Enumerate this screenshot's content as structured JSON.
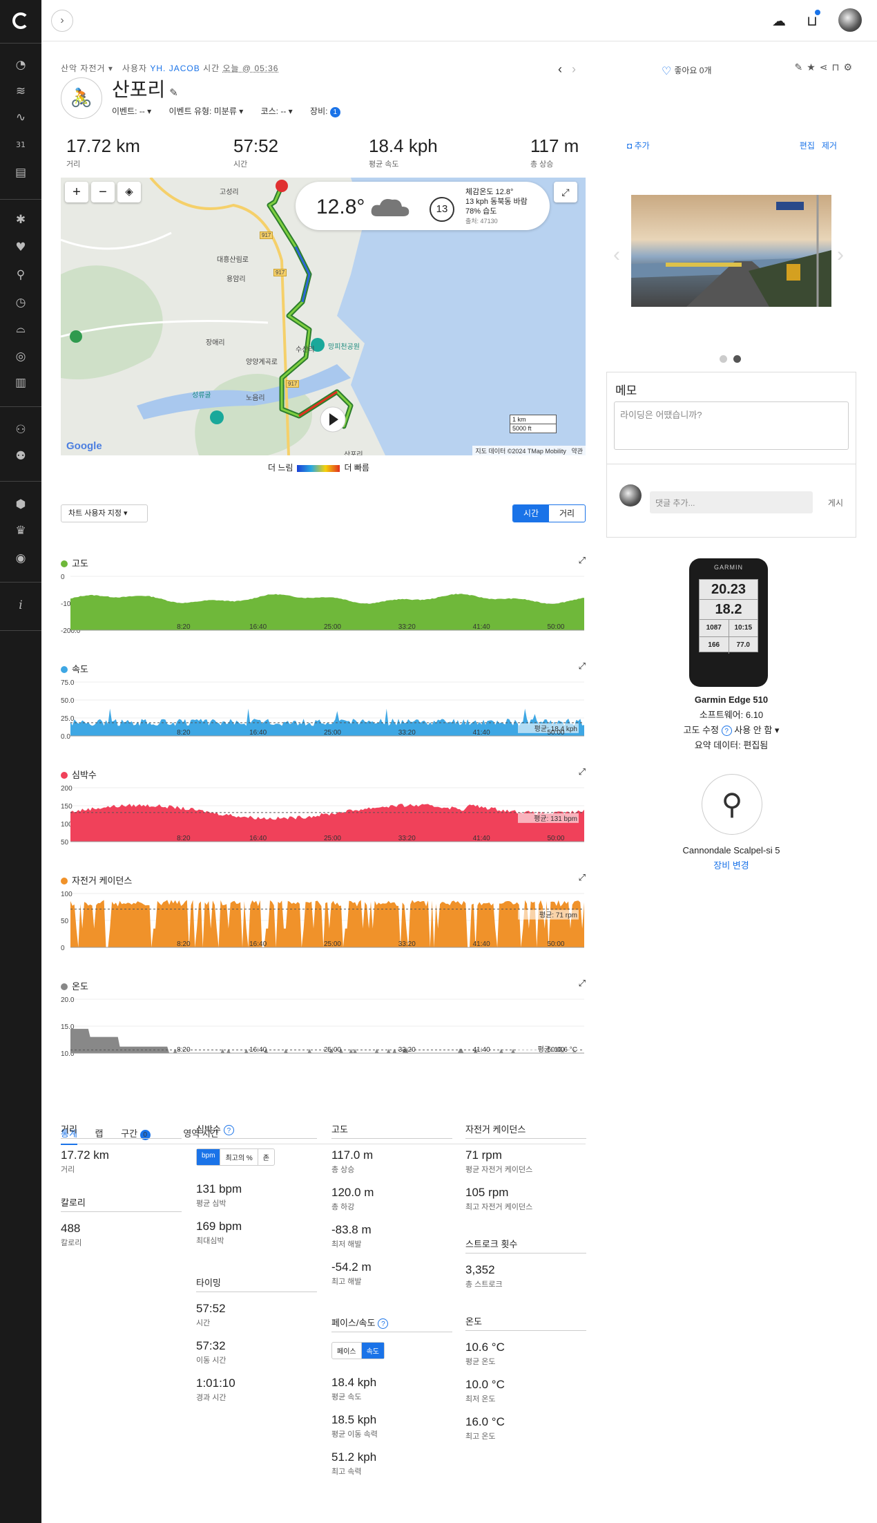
{
  "breadcrumb": {
    "type": "산악 자전거",
    "user_prefix": "사용자",
    "user": "YH. JACOB",
    "time_prefix": "시간",
    "time": "오늘 @ 05:36"
  },
  "activity": {
    "title": "산포리",
    "event_label": "이벤트:",
    "event_value": "--",
    "event_type_label": "이벤트 유형:",
    "event_type_value": "미분류",
    "course_label": "코스:",
    "course_value": "--",
    "gear_label": "장비:",
    "gear_count": "1"
  },
  "summary": [
    {
      "value": "17.72 km",
      "label": "거리"
    },
    {
      "value": "57:52",
      "label": "시간"
    },
    {
      "value": "18.4 kph",
      "label": "평균 속도"
    },
    {
      "value": "117 m",
      "label": "총 상승"
    }
  ],
  "map": {
    "places": [
      "고성리",
      "용암리",
      "대흥산림로",
      "장애리",
      "수산리",
      "양양계곡로",
      "성류굴",
      "노음리",
      "산포리",
      "917",
      "917",
      "917",
      "망피천공원"
    ],
    "attribution": "지도 데이터 ©2024 TMap Mobility",
    "terms": "약관",
    "google": "Google",
    "scale_km": "1 km",
    "scale_ft": "5000 ft",
    "weather": {
      "temp": "12.8°",
      "wind_speed": "13",
      "feels": "체감온도 12.8°",
      "wind": "13 kph 동북동 바람",
      "humidity": "78% 습도",
      "source": "출처: 47130"
    }
  },
  "map_legend": {
    "slow": "더 느림",
    "fast": "더 빠름"
  },
  "chart_controls": {
    "custom": "차트 사용자 지정",
    "time": "시간",
    "distance": "거리"
  },
  "x_ticks": [
    "8:20",
    "16:40",
    "25:00",
    "33:20",
    "41:40",
    "50:00"
  ],
  "charts": {
    "elevation": {
      "title": "고도",
      "color": "#6fb83a",
      "y_ticks": [
        "0",
        "-100.0",
        "-200.0"
      ],
      "ylim": [
        -200,
        0
      ]
    },
    "speed": {
      "title": "속도",
      "color": "#3ea7e4",
      "y_ticks": [
        "75.0",
        "50.0",
        "25.0",
        "0.0"
      ],
      "ylim": [
        0,
        75
      ],
      "avg_label": "평균: 18.4 kph",
      "avg": 18.4
    },
    "heart_rate": {
      "title": "심박수",
      "color": "#f0415a",
      "y_ticks": [
        "200",
        "150",
        "100",
        "50"
      ],
      "ylim": [
        50,
        200
      ],
      "avg_label": "평균: 131 bpm",
      "avg": 131
    },
    "cadence": {
      "title": "자전거 케이던스",
      "color": "#f0922a",
      "y_ticks": [
        "100",
        "50",
        "0"
      ],
      "ylim": [
        0,
        100
      ],
      "avg_label": "평균: 71 rpm",
      "avg": 71
    },
    "temperature": {
      "title": "온도",
      "color": "#888888",
      "y_ticks": [
        "20.0",
        "15.0",
        "10.0"
      ],
      "ylim": [
        10,
        20
      ],
      "avg_label": "평균: 10.6 °C",
      "avg": 10.6
    }
  },
  "tabs": [
    "통계",
    "랩",
    "구간",
    "영역 시간"
  ],
  "segments_count": "0",
  "stats": {
    "distance": {
      "title": "거리",
      "items": [
        {
          "value": "17.72 km",
          "label": "거리"
        }
      ]
    },
    "calories": {
      "title": "칼로리",
      "items": [
        {
          "value": "488",
          "label": "칼로리"
        }
      ]
    },
    "heart_rate": {
      "title": "심박수",
      "toggle": [
        "bpm",
        "최고의 %",
        "존"
      ],
      "items": [
        {
          "value": "131 bpm",
          "label": "평균 심박"
        },
        {
          "value": "169 bpm",
          "label": "최대심박"
        }
      ]
    },
    "timing": {
      "title": "타이밍",
      "items": [
        {
          "value": "57:52",
          "label": "시간"
        },
        {
          "value": "57:32",
          "label": "이동 시간"
        },
        {
          "value": "1:01:10",
          "label": "경과 시간"
        }
      ]
    },
    "elevation": {
      "title": "고도",
      "items": [
        {
          "value": "117.0 m",
          "label": "총 상승"
        },
        {
          "value": "120.0 m",
          "label": "총 하강"
        },
        {
          "value": "-83.8 m",
          "label": "최저 해발"
        },
        {
          "value": "-54.2 m",
          "label": "최고 해발"
        }
      ]
    },
    "pace_speed": {
      "title": "페이스/속도",
      "toggle": [
        "페이스",
        "속도"
      ],
      "items": [
        {
          "value": "18.4 kph",
          "label": "평균 속도"
        },
        {
          "value": "18.5 kph",
          "label": "평균 이동 속력"
        },
        {
          "value": "51.2 kph",
          "label": "최고 속력"
        }
      ]
    },
    "cadence": {
      "title": "자전거 케이던스",
      "items": [
        {
          "value": "71 rpm",
          "label": "평균 자전거 케이던스"
        },
        {
          "value": "105 rpm",
          "label": "최고 자전거 케이던스"
        }
      ]
    },
    "strokes": {
      "title": "스트로크 횟수",
      "items": [
        {
          "value": "3,352",
          "label": "총 스트로크"
        }
      ]
    },
    "temperature": {
      "title": "온도",
      "items": [
        {
          "value": "10.6 °C",
          "label": "평균 온도"
        },
        {
          "value": "10.0 °C",
          "label": "최저 온도"
        },
        {
          "value": "16.0 °C",
          "label": "최고 온도"
        }
      ]
    }
  },
  "right": {
    "likes": "좋아요 0개",
    "add_photo": "추가",
    "edit": "편집",
    "remove": "제거",
    "memo_title": "메모",
    "memo_placeholder": "라이딩은 어땠습니까?",
    "comment_placeholder": "댓글 추가...",
    "post": "게시",
    "device_brand": "GARMIN",
    "device_screen": [
      "20.23",
      "18.2",
      "1087",
      "10:15",
      "166",
      "77.0"
    ],
    "device": {
      "name": "Garmin Edge 510",
      "software_label": "소프트웨어:",
      "software": "6.10",
      "elev_label": "고도 수정",
      "elev_value": "사용 안 함",
      "summary_label": "요약 데이터:",
      "summary_value": "편집됨"
    },
    "bike": {
      "name": "Cannondale Scalpel-si 5",
      "change": "장비 변경"
    }
  }
}
